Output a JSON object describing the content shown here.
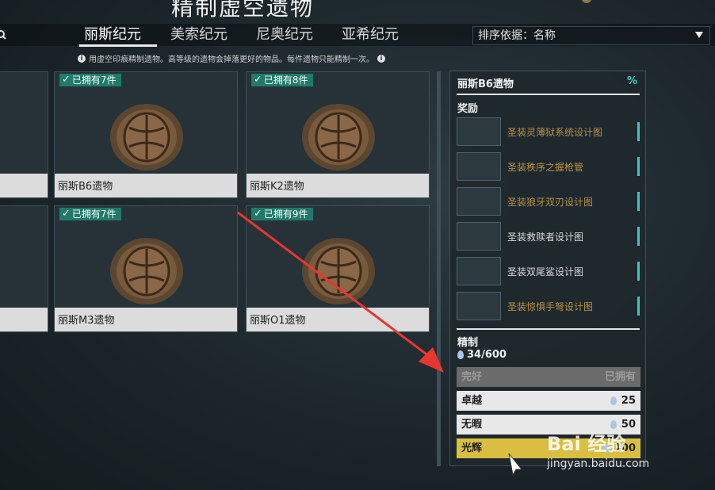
{
  "header": {
    "title": "精制虚空遗物",
    "search_icon": "search-icon",
    "tabs": [
      {
        "label": "丽斯纪元",
        "active": true
      },
      {
        "label": "美索纪元",
        "active": false
      },
      {
        "label": "尼奥纪元",
        "active": false
      },
      {
        "label": "亚希纪元",
        "active": false
      }
    ],
    "sort": {
      "label": "排序依据：名称",
      "icon": "chevron-down-icon"
    },
    "hint": "用虚空印痕精制遗物。高等级的遗物会掉落更好的物品。每件遗物只能精制一次。"
  },
  "relics": [
    {
      "name": "丽斯B6遗物",
      "owned": "已拥有7件"
    },
    {
      "name": "丽斯K2遗物",
      "owned": "已拥有8件"
    },
    {
      "name": "丽斯M3遗物",
      "owned": "已拥有7件"
    },
    {
      "name": "丽斯O1遗物",
      "owned": "已拥有9件"
    }
  ],
  "panel": {
    "title": "丽斯B6遗物",
    "percent_label": "%",
    "rewards_label": "奖励",
    "rewards": [
      {
        "name": "圣装灵薄狱系统设计图",
        "rarity_color": "#b98e45"
      },
      {
        "name": "圣装秩序之握枪管",
        "rarity_color": "#b98e45"
      },
      {
        "name": "圣装狼牙双刃设计图",
        "rarity_color": "#b98e45"
      },
      {
        "name": "圣装救赎者设计图",
        "rarity_color": "#dadada"
      },
      {
        "name": "圣装双尾鲨设计图",
        "rarity_color": "#dadada"
      },
      {
        "name": "圣装惊惧手弩设计图",
        "rarity_color": "#b98e45"
      }
    ],
    "refine_label": "精制",
    "traces": "34/600",
    "refinements": [
      {
        "label": "完好",
        "value": "已拥有",
        "state": "owned"
      },
      {
        "label": "卓越",
        "value": "25",
        "state": "available"
      },
      {
        "label": "无暇",
        "value": "50",
        "state": "available"
      },
      {
        "label": "光辉",
        "value": "100",
        "state": "selected"
      }
    ]
  },
  "watermark": {
    "main": "Bai 经验",
    "sub": "jingyan.baidu.com"
  },
  "colors": {
    "accent_teal": "#3fc6c0",
    "badge_green": "#1f7a6a",
    "selected_gold": "#d9be42",
    "legendary_text": "#b98e45",
    "arrow_red": "#e8362f"
  }
}
